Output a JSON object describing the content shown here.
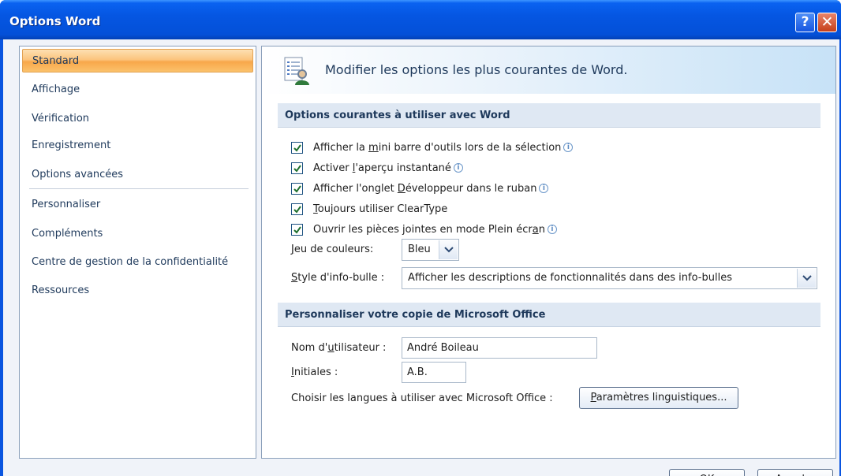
{
  "window": {
    "title": "Options Word",
    "help_glyph": "?",
    "close_glyph": "✕"
  },
  "sidebar": {
    "items": [
      {
        "label": "Standard",
        "selected": true
      },
      {
        "label": "Affichage"
      },
      {
        "label": "Vérification"
      },
      {
        "label": "Enregistrement"
      },
      {
        "label": "Options avancées"
      },
      {
        "label": "Personnaliser"
      },
      {
        "label": "Compléments"
      },
      {
        "label": "Centre de gestion de la confidentialité"
      },
      {
        "label": "Ressources"
      }
    ]
  },
  "main": {
    "header": "Modifier les options les plus courantes de Word.",
    "section1": {
      "title": "Options courantes à utiliser avec Word",
      "checkboxes": [
        {
          "pre": "Afficher la ",
          "ul": "m",
          "post": "ini barre d'outils lors de la sélection",
          "checked": true,
          "info": true
        },
        {
          "pre": "Activer ",
          "ul": "l",
          "post": "'aperçu instantané",
          "checked": true,
          "info": true
        },
        {
          "pre": "Afficher l'onglet ",
          "ul": "D",
          "post": "éveloppeur dans le ruban",
          "checked": true,
          "info": true
        },
        {
          "pre": "",
          "ul": "T",
          "post": "oujours utiliser ClearType",
          "checked": true,
          "info": false
        },
        {
          "pre": "Ouvrir les pièces jointes en mode Plein écr",
          "ul": "a",
          "post": "n",
          "checked": true,
          "info": true
        }
      ],
      "color_scheme": {
        "label_ul": "J",
        "label_rest": "eu de couleurs:",
        "value": "Bleu"
      },
      "tooltip_style": {
        "label_ul": "S",
        "label_rest": "tyle d'info-bulle :",
        "value": "Afficher les descriptions de fonctionnalités dans des info-bulles"
      }
    },
    "section2": {
      "title": "Personnaliser votre copie de Microsoft Office",
      "username": {
        "label_pre": "Nom d'",
        "label_ul": "u",
        "label_post": "tilisateur :",
        "value": "André Boileau"
      },
      "initials": {
        "label_ul": "I",
        "label_post": "nitiales :",
        "value": "A.B."
      },
      "languages": {
        "label": "Choisir les langues à utiliser avec Microsoft Office :",
        "button_ul": "P",
        "button_rest": "aramètres linguistiques..."
      }
    }
  },
  "footer": {
    "ok_label": "OK",
    "cancel_label": "Annuler"
  },
  "colors": {
    "accent": "#0556e2",
    "selected_item": "#f8a74a",
    "section_bg": "#dfe8f3"
  }
}
